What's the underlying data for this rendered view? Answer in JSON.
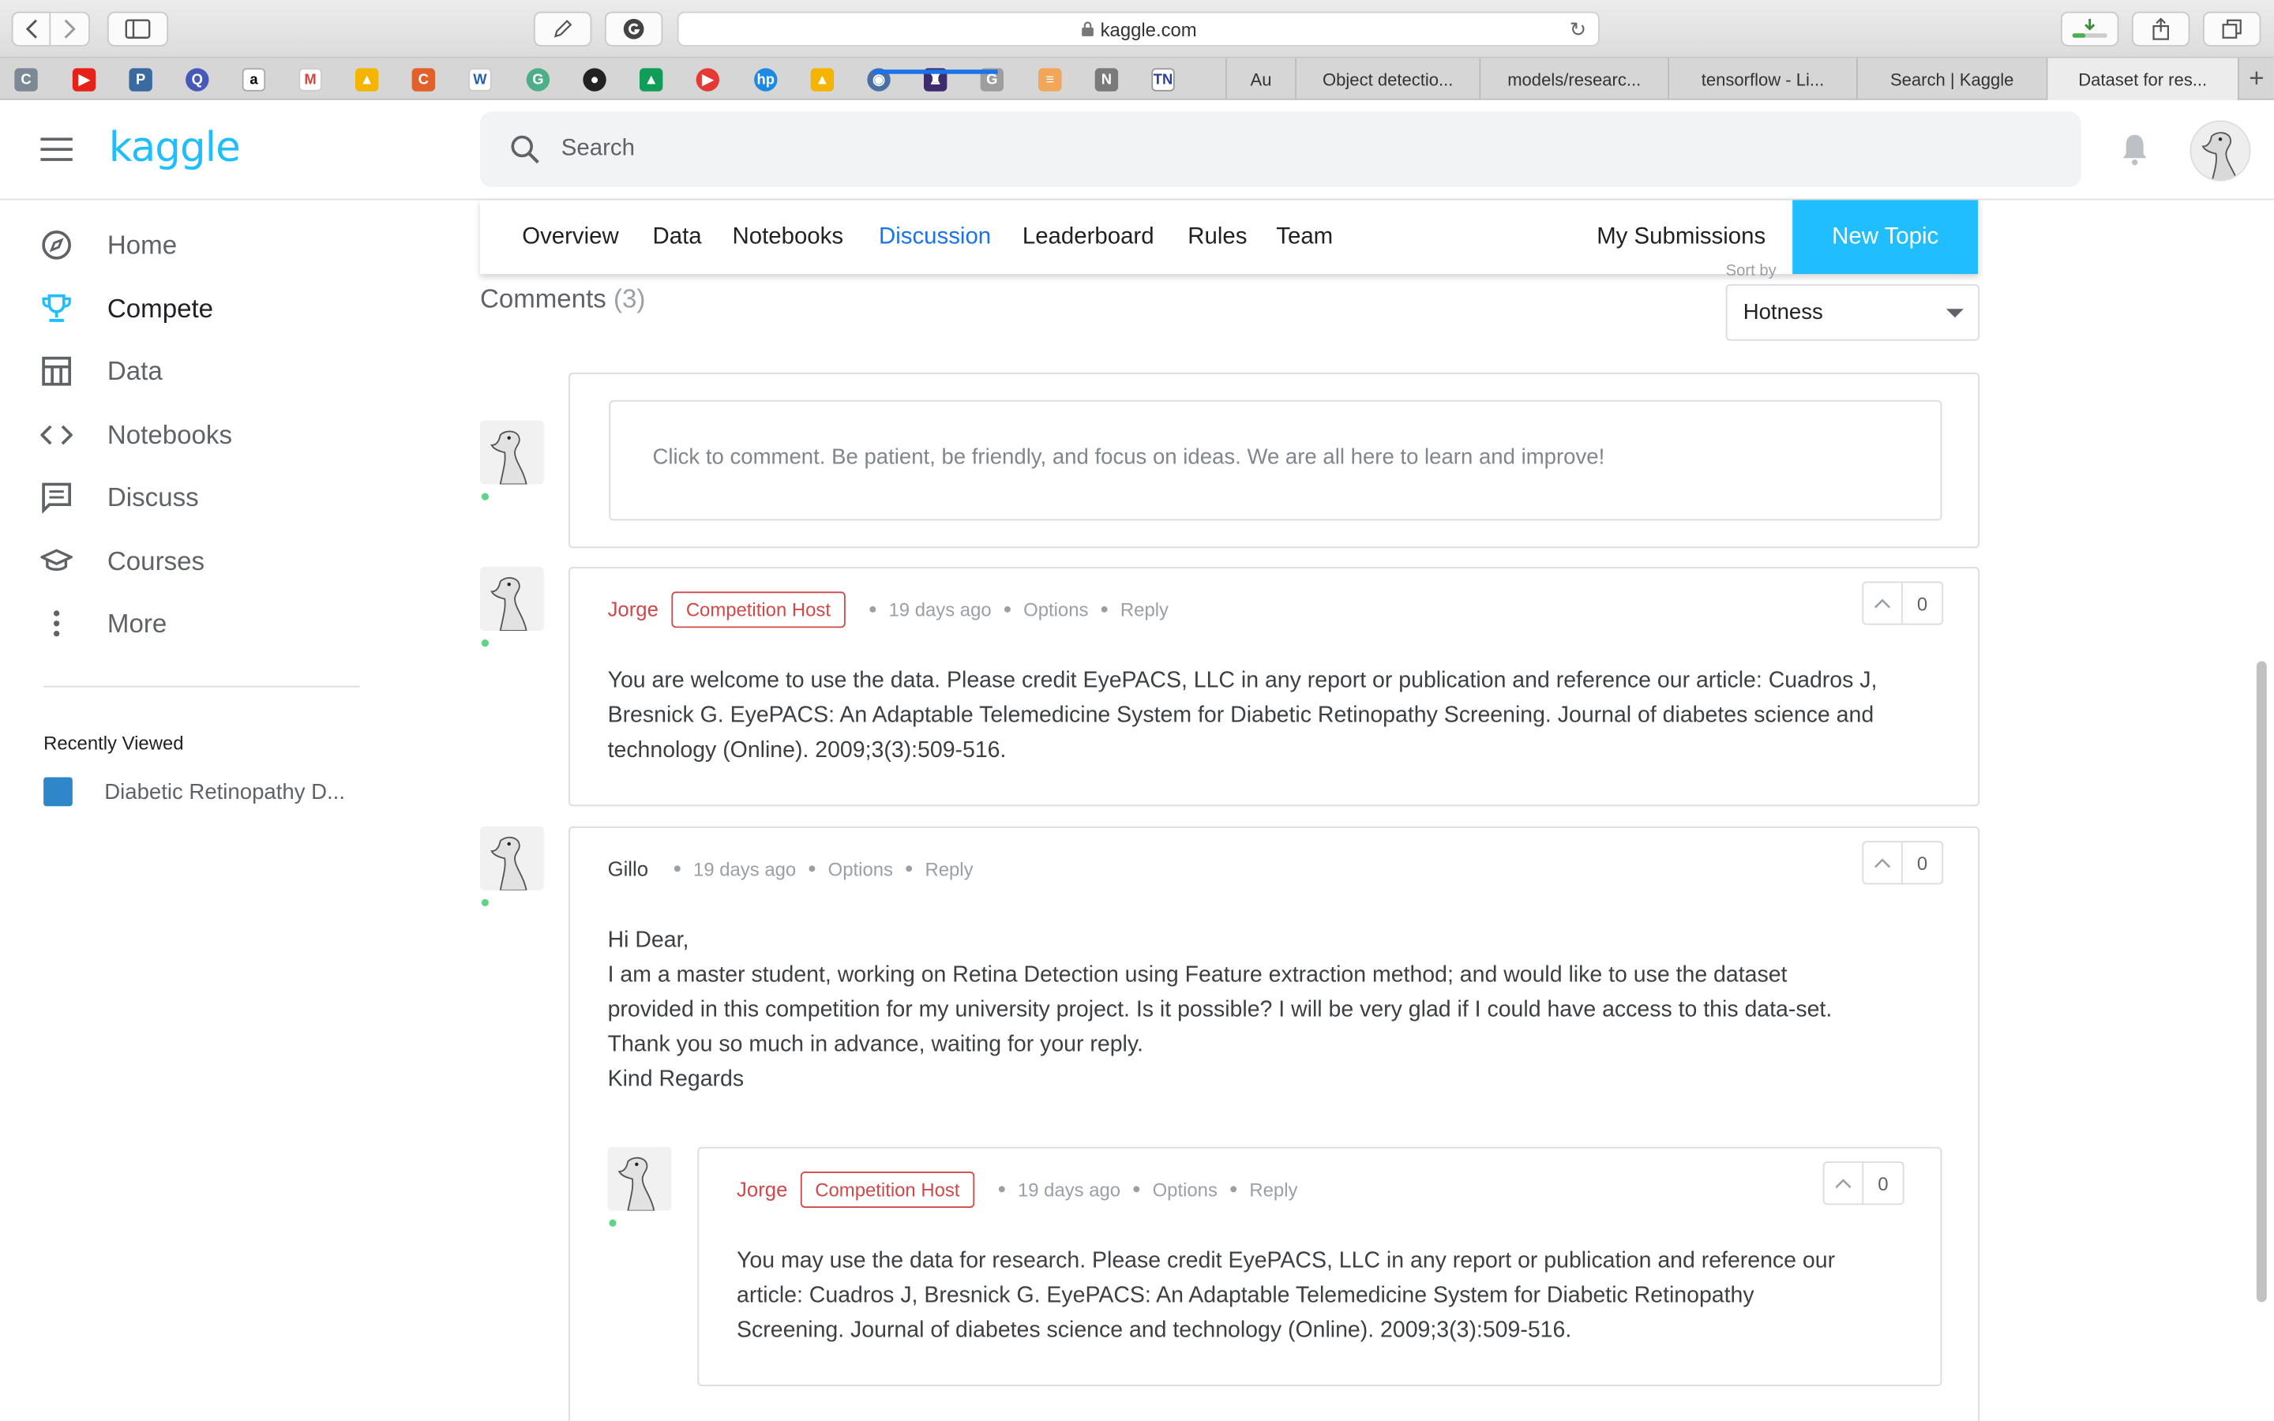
{
  "browser": {
    "url": "kaggle.com",
    "tabs": [
      {
        "label": "Au"
      },
      {
        "label": "Object detectio..."
      },
      {
        "label": "models/researc..."
      },
      {
        "label": "tensorflow - Li..."
      },
      {
        "label": "Search | Kaggle"
      },
      {
        "label": "Dataset for res..."
      }
    ]
  },
  "header": {
    "logo": "kaggle",
    "search_placeholder": "Search"
  },
  "sidebar": {
    "items": [
      {
        "label": "Home"
      },
      {
        "label": "Compete"
      },
      {
        "label": "Data"
      },
      {
        "label": "Notebooks"
      },
      {
        "label": "Discuss"
      },
      {
        "label": "Courses"
      },
      {
        "label": "More"
      }
    ],
    "recent_heading": "Recently Viewed",
    "recent_item": "Diabetic Retinopathy D..."
  },
  "competition_tabs": {
    "tabs": [
      "Overview",
      "Data",
      "Notebooks",
      "Discussion",
      "Leaderboard",
      "Rules",
      "Team"
    ],
    "my_submissions": "My Submissions",
    "new_topic": "New Topic"
  },
  "comments": {
    "heading": "Comments",
    "count": "(3)",
    "sort_label": "Sort by",
    "sort_value": "Hotness",
    "placeholder": "Click to comment. Be patient, be friendly, and focus on ideas. We are all here to learn and improve!",
    "items": [
      {
        "author": "Jorge",
        "badge": "Competition Host",
        "time": "19 days ago",
        "options": "Options",
        "reply": "Reply",
        "votes": "0",
        "lines": [
          "You are welcome to use the data. Please credit EyePACS, LLC in any report or publication and reference our article: Cuadros J,",
          "Bresnick G. EyePACS: An Adaptable Telemedicine System for Diabetic Retinopathy Screening. Journal of diabetes science and",
          "technology (Online). 2009;3(3):509-516."
        ]
      },
      {
        "author": "Gillo",
        "time": "19 days ago",
        "options": "Options",
        "reply": "Reply",
        "votes": "0",
        "lines": [
          "Hi Dear,",
          "I am a master student, working on Retina Detection using Feature extraction method; and would like to use the dataset",
          "provided in this competition for my university project. Is it possible? I will be very glad if I could have access to this data-set.",
          "Thank you so much in advance, waiting for your reply.",
          "Kind Regards"
        ]
      },
      {
        "author": "Jorge",
        "badge": "Competition Host",
        "time": "19 days ago",
        "options": "Options",
        "reply": "Reply",
        "votes": "0",
        "lines": [
          "You may use the data for research. Please credit EyePACS, LLC in any report or publication and reference our",
          "article: Cuadros J, Bresnick G. EyePACS: An Adaptable Telemedicine System for Diabetic Retinopathy",
          "Screening. Journal of diabetes science and technology (Online). 2009;3(3):509-516."
        ]
      }
    ]
  },
  "colors": {
    "kaggle_blue": "#20beff",
    "link_blue": "#1a73e8",
    "host_red": "#d0494a",
    "online_green": "#5fd38a"
  }
}
